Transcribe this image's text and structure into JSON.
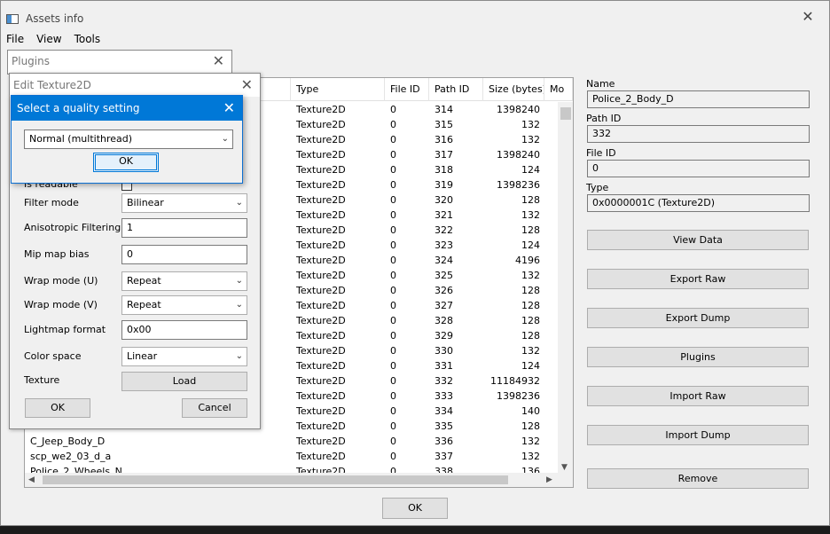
{
  "window": {
    "title": "Assets info",
    "close": "✕"
  },
  "menu": [
    "File",
    "View",
    "Tools"
  ],
  "table": {
    "headers": [
      "Type",
      "File ID",
      "Path ID",
      "Size (bytes)",
      "Mo"
    ],
    "rows": [
      {
        "name": "",
        "type": "Texture2D",
        "file_id": "0",
        "path_id": "314",
        "size": "1398240"
      },
      {
        "name": "",
        "type": "Texture2D",
        "file_id": "0",
        "path_id": "315",
        "size": "132"
      },
      {
        "name": "",
        "type": "Texture2D",
        "file_id": "0",
        "path_id": "316",
        "size": "132"
      },
      {
        "name": "",
        "type": "Texture2D",
        "file_id": "0",
        "path_id": "317",
        "size": "1398240"
      },
      {
        "name": "",
        "type": "Texture2D",
        "file_id": "0",
        "path_id": "318",
        "size": "124"
      },
      {
        "name": "",
        "type": "Texture2D",
        "file_id": "0",
        "path_id": "319",
        "size": "1398236"
      },
      {
        "name": "",
        "type": "Texture2D",
        "file_id": "0",
        "path_id": "320",
        "size": "128"
      },
      {
        "name": "",
        "type": "Texture2D",
        "file_id": "0",
        "path_id": "321",
        "size": "132"
      },
      {
        "name": "",
        "type": "Texture2D",
        "file_id": "0",
        "path_id": "322",
        "size": "128"
      },
      {
        "name": "",
        "type": "Texture2D",
        "file_id": "0",
        "path_id": "323",
        "size": "124"
      },
      {
        "name": "",
        "type": "Texture2D",
        "file_id": "0",
        "path_id": "324",
        "size": "4196"
      },
      {
        "name": "",
        "type": "Texture2D",
        "file_id": "0",
        "path_id": "325",
        "size": "132"
      },
      {
        "name": "",
        "type": "Texture2D",
        "file_id": "0",
        "path_id": "326",
        "size": "128"
      },
      {
        "name": "",
        "type": "Texture2D",
        "file_id": "0",
        "path_id": "327",
        "size": "128"
      },
      {
        "name": "",
        "type": "Texture2D",
        "file_id": "0",
        "path_id": "328",
        "size": "128"
      },
      {
        "name": "",
        "type": "Texture2D",
        "file_id": "0",
        "path_id": "329",
        "size": "128"
      },
      {
        "name": "",
        "type": "Texture2D",
        "file_id": "0",
        "path_id": "330",
        "size": "132"
      },
      {
        "name": "",
        "type": "Texture2D",
        "file_id": "0",
        "path_id": "331",
        "size": "124"
      },
      {
        "name": "",
        "type": "Texture2D",
        "file_id": "0",
        "path_id": "332",
        "size": "11184932"
      },
      {
        "name": "",
        "type": "Texture2D",
        "file_id": "0",
        "path_id": "333",
        "size": "1398236"
      },
      {
        "name": "",
        "type": "Texture2D",
        "file_id": "0",
        "path_id": "334",
        "size": "140"
      },
      {
        "name": "",
        "type": "Texture2D",
        "file_id": "0",
        "path_id": "335",
        "size": "128"
      },
      {
        "name": "C_Jeep_Body_D",
        "type": "Texture2D",
        "file_id": "0",
        "path_id": "336",
        "size": "132"
      },
      {
        "name": "scp_we2_03_d_a",
        "type": "Texture2D",
        "file_id": "0",
        "path_id": "337",
        "size": "132"
      },
      {
        "name": "Police_2_Wheels_N",
        "type": "Texture2D",
        "file_id": "0",
        "path_id": "338",
        "size": "136"
      }
    ]
  },
  "details": {
    "name_label": "Name",
    "name_value": "Police_2_Body_D",
    "path_id_label": "Path ID",
    "path_id_value": "332",
    "file_id_label": "File ID",
    "file_id_value": "0",
    "type_label": "Type",
    "type_value": "0x0000001C (Texture2D)"
  },
  "buttons": {
    "view_data": "View Data",
    "export_raw": "Export Raw",
    "export_dump": "Export Dump",
    "plugins": "Plugins",
    "import_raw": "Import Raw",
    "import_dump": "Import Dump",
    "remove": "Remove",
    "ok": "OK"
  },
  "plugins_window": {
    "title": "Plugins",
    "close": "✕"
  },
  "edit_dialog": {
    "title": "Edit Texture2D",
    "close": "✕",
    "readable_label": "Is readable",
    "filter_mode_label": "Filter mode",
    "filter_mode_value": "Bilinear",
    "aniso_label": "Anisotropic Filtering",
    "aniso_value": "1",
    "mip_bias_label": "Mip map bias",
    "mip_bias_value": "0",
    "wrap_u_label": "Wrap mode (U)",
    "wrap_u_value": "Repeat",
    "wrap_v_label": "Wrap mode (V)",
    "wrap_v_value": "Repeat",
    "lightmap_label": "Lightmap format",
    "lightmap_value": "0x00",
    "color_space_label": "Color space",
    "color_space_value": "Linear",
    "texture_label": "Texture",
    "load_button": "Load",
    "ok_button": "OK",
    "cancel_button": "Cancel"
  },
  "quality_dialog": {
    "title": "Select a quality setting",
    "close": "✕",
    "selected": "Normal (multithread)",
    "ok_button": "OK"
  },
  "colors": {
    "accent": "#0078d7",
    "window_bg": "#f0f0f0",
    "desktop": "#1b1b1b"
  }
}
